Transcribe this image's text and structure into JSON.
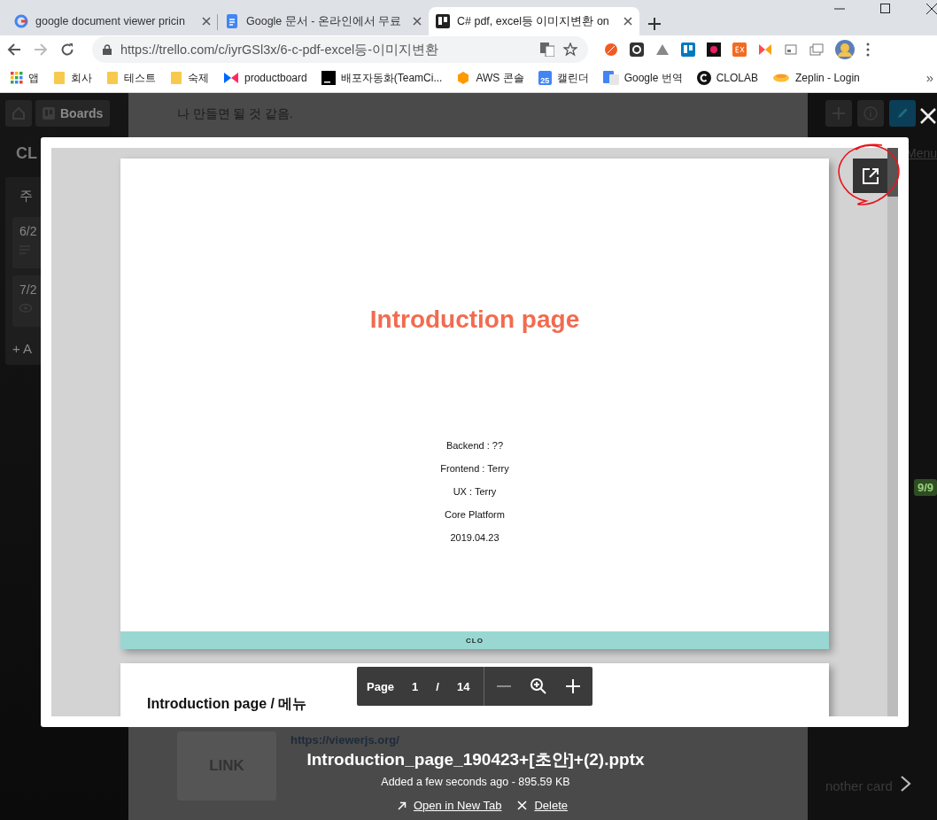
{
  "tabs": [
    {
      "title": "google document viewer pricin",
      "kind": "google",
      "selected": false
    },
    {
      "title": "Google 문서 - 온라인에서 무료",
      "kind": "docs",
      "selected": false
    },
    {
      "title": "C# pdf, excel등 이미지변환 on",
      "kind": "trello",
      "selected": true
    }
  ],
  "address": {
    "url": "https://trello.com/c/iyrGSl3x/6-c-pdf-excel등-이미지변환"
  },
  "bookmarks": [
    {
      "label": "앱",
      "kind": "apps"
    },
    {
      "label": "회사",
      "kind": "folder"
    },
    {
      "label": "테스트",
      "kind": "folder"
    },
    {
      "label": "숙제",
      "kind": "folder"
    },
    {
      "label": "productboard",
      "kind": "productboard"
    },
    {
      "label": "배포자동화(TeamCi...",
      "kind": "teamcity"
    },
    {
      "label": "AWS 콘솔",
      "kind": "aws"
    },
    {
      "label": "캘린더",
      "kind": "calendar",
      "icon_text": "25"
    },
    {
      "label": "Google 번역",
      "kind": "translate"
    },
    {
      "label": "CLOLAB",
      "kind": "clolab"
    },
    {
      "label": "Zeplin - Login",
      "kind": "zeplin"
    }
  ],
  "bookmarks_overflow": "»",
  "background": {
    "nav_boards": "Boards",
    "board_title": "CL",
    "list_title": "주",
    "cards": [
      "6/2",
      "7/2"
    ],
    "add_card": "+ A",
    "menu": "Menu",
    "badge": "9/9",
    "description_lines": [
      "나 만들면 될 것 같음."
    ],
    "attachment_thumb": "LINK",
    "attachment_link": "https://viewerjs.org/",
    "right_card": "nother card"
  },
  "preview": {
    "slides": [
      {
        "title": "Introduction page",
        "lines": [
          "Backend : ??",
          "Frontend : Terry",
          "UX : Terry",
          "Core Platform",
          "2019.04.23"
        ],
        "footer": "CLO"
      },
      {
        "title": "Introduction page / 메뉴"
      }
    ],
    "toolbar": {
      "page_label": "Page",
      "page": "1",
      "separator": "/",
      "total": "14"
    },
    "file_name": "Introduction_page_190423+[초안]+(2).pptx",
    "meta": "Added a few seconds ago - 895.59 KB",
    "actions": [
      {
        "label": "Open in New Tab",
        "kind": "open"
      },
      {
        "label": "Delete",
        "kind": "delete"
      }
    ]
  }
}
